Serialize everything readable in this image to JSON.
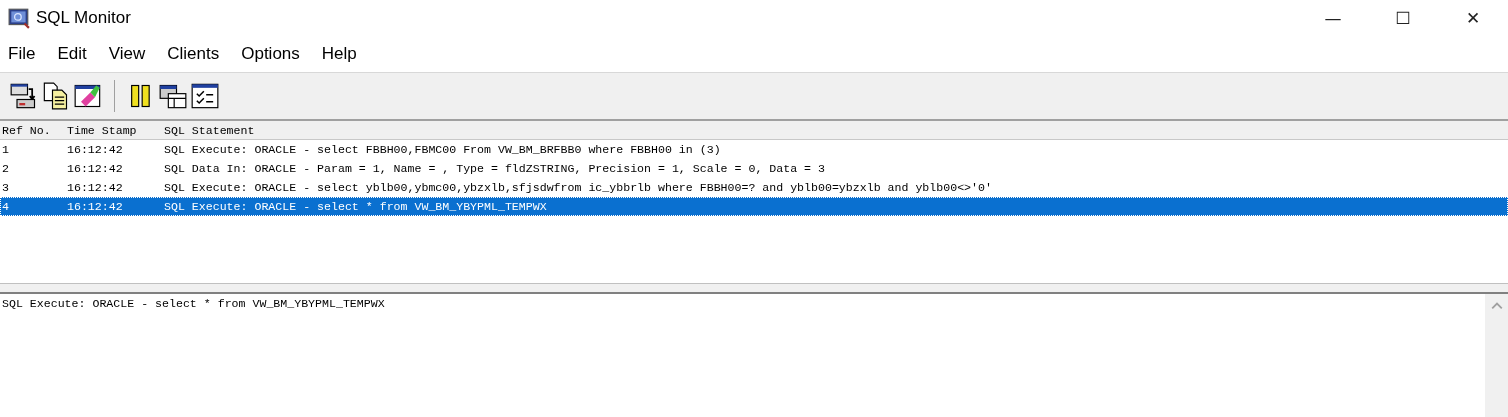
{
  "window": {
    "title": "SQL Monitor",
    "controls": [
      "—",
      "☐",
      "✕"
    ]
  },
  "menu": [
    "File",
    "Edit",
    "View",
    "Clients",
    "Options",
    "Help"
  ],
  "toolbar": [
    {
      "kind": "save-log"
    },
    {
      "kind": "copy"
    },
    {
      "kind": "clear"
    },
    {
      "kind": "separator"
    },
    {
      "kind": "pause"
    },
    {
      "kind": "windows"
    },
    {
      "kind": "checklist"
    }
  ],
  "table": {
    "columns": [
      "Ref No.",
      "Time Stamp",
      "SQL Statement"
    ],
    "rows": [
      {
        "ref": "1",
        "time": "16:12:42",
        "sql": "SQL Execute: ORACLE - select FBBH00,FBMC00 From VW_BM_BRFBB0 where  FBBH00 in (3)",
        "selected": false
      },
      {
        "ref": "2",
        "time": "16:12:42",
        "sql": "SQL Data In: ORACLE - Param = 1, Name = , Type = fldZSTRING, Precision = 1, Scale = 0, Data = 3",
        "selected": false
      },
      {
        "ref": "3",
        "time": "16:12:42",
        "sql": "SQL Execute: ORACLE - select yblb00,ybmc00,ybzxlb,sfjsdwfrom ic_ybbrlb where FBBH00=? and yblb00=ybzxlb and yblb00<>'0'",
        "selected": false
      },
      {
        "ref": "4",
        "time": "16:12:42",
        "sql": "SQL Execute: ORACLE - select * from VW_BM_YBYPML_TEMPWX",
        "selected": true
      }
    ]
  },
  "detail": {
    "text": "SQL Execute: ORACLE - select * from VW_BM_YBYPML_TEMPWX"
  }
}
